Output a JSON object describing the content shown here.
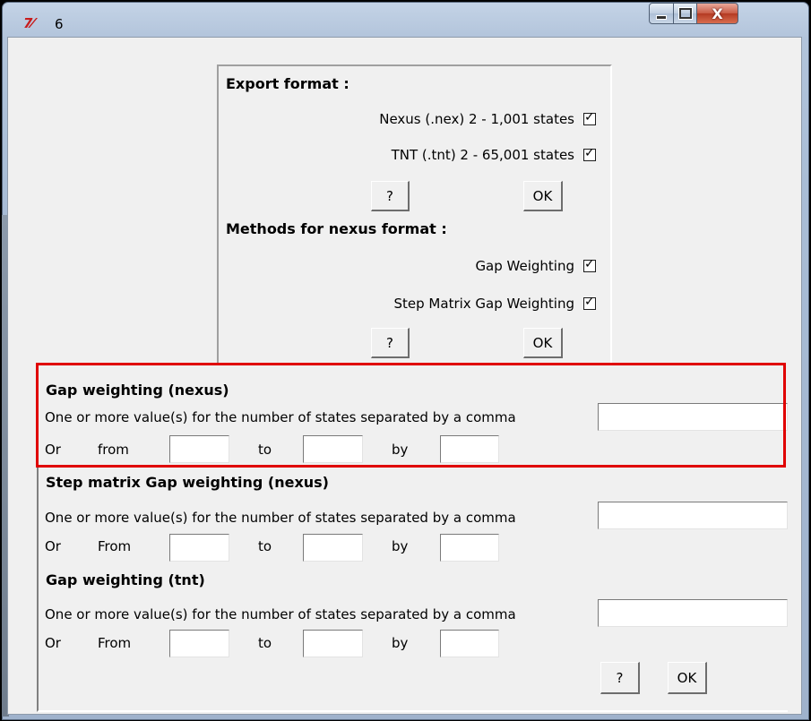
{
  "window": {
    "icon": "tk-feather-icon",
    "icon_glyph": "7⁄",
    "title": "6",
    "minimize_icon": "minimize-icon",
    "maximize_icon": "maximize-icon",
    "close_icon": "close-icon",
    "close_glyph": "X"
  },
  "export": {
    "title": "Export format :",
    "nexus_label": "Nexus (.nex) 2 - 1,001 states",
    "nexus_checked": true,
    "tnt_label": "TNT (.tnt) 2 - 65,001 states",
    "tnt_checked": true,
    "help_label": "?",
    "ok_label": "OK"
  },
  "methods": {
    "title": "Methods for nexus format :",
    "gap_label": "Gap Weighting",
    "gap_checked": true,
    "step_label": "Step Matrix Gap Weighting",
    "step_checked": true,
    "help_label": "?",
    "ok_label": "OK"
  },
  "sections": {
    "gap_nexus": {
      "title": "Gap weighting (nexus)",
      "desc": "One or more value(s) for the number of states separated by a comma",
      "or": "Or",
      "from": "from",
      "to": "to",
      "by": "by"
    },
    "step_nexus": {
      "title": "Step matrix Gap weighting (nexus)",
      "desc": "One or more value(s) for the number of states separated by a comma",
      "or": "Or",
      "from": "From",
      "to": "to",
      "by": "by"
    },
    "gap_tnt": {
      "title": "Gap weighting (tnt)",
      "desc": "One or more value(s) for the number of states separated by a comma",
      "or": "Or",
      "from": "From",
      "to": "to",
      "by": "by"
    }
  },
  "bottom_buttons": {
    "help_label": "?",
    "ok_label": "OK"
  },
  "colors": {
    "highlight": "#e00000",
    "client_bg": "#f0f0f0"
  }
}
